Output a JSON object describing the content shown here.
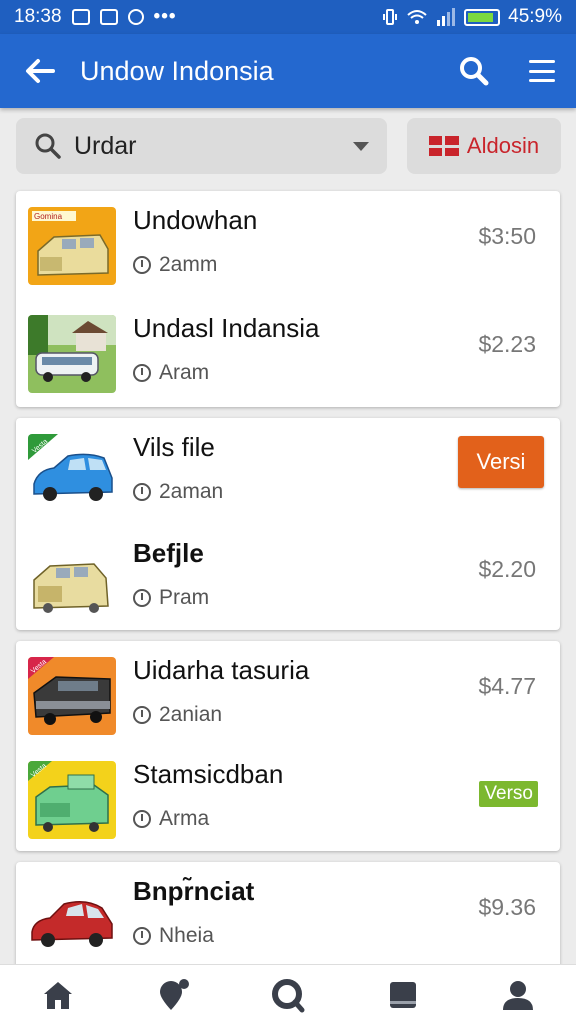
{
  "status_bar": {
    "time": "18:38",
    "battery": "45:9%",
    "battery_level": 0.88
  },
  "app_bar": {
    "title": "Undow Indonsia",
    "back_icon": "arrow-left-icon",
    "search_icon": "search-icon",
    "menu_icon": "menu-icon"
  },
  "filter": {
    "search_value": "Urdar",
    "language_label": "Aldosin"
  },
  "items": [
    {
      "name": "Undowhan",
      "meta": "2amm",
      "price": "$3:50"
    },
    {
      "name": "Undasl Indansia",
      "meta": "Aram",
      "price": "$2.23"
    },
    {
      "name": "Vils file",
      "meta": "2aman",
      "badge": "Versi"
    },
    {
      "name": "Befjle",
      "meta": "Pram",
      "price": "$2.20"
    },
    {
      "name": "Uidarha tasuria",
      "meta": "2anian",
      "price": "$4.77"
    },
    {
      "name": "Stamsicdban",
      "meta": "Arma",
      "badge": "Verso"
    },
    {
      "name": "Bnpr̃nciat",
      "meta": "Nheia",
      "price": "$9.36"
    }
  ],
  "thumb_tags": {
    "item0": "Gomina",
    "item2": "Vesta",
    "item4": "Vesta",
    "item5": "Vesta"
  },
  "bottom_nav": [
    "home-icon",
    "location-icon",
    "search-icon",
    "library-icon",
    "profile-icon"
  ],
  "colors": {
    "app_bar": "#2468cf",
    "status_bar": "#1f5fc0",
    "badge_orange": "#e2611b",
    "badge_green": "#7cb82f",
    "language_red": "#c9242b"
  }
}
